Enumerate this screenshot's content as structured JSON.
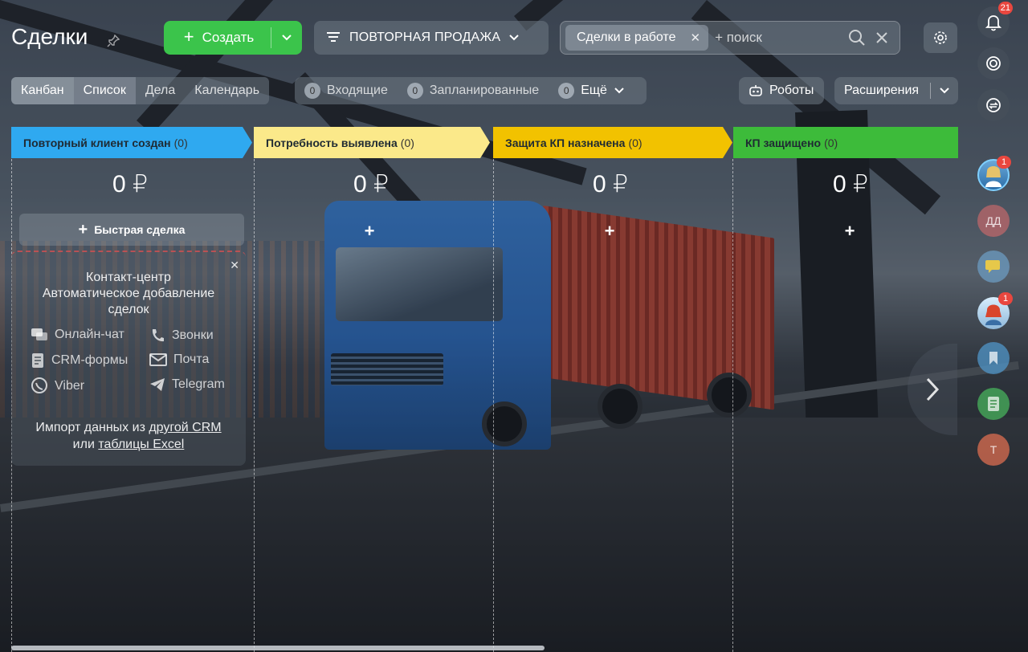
{
  "header": {
    "title": "Сделки",
    "create_label": "Создать",
    "filter_label": "ПОВТОРНАЯ ПРОДАЖА",
    "search_chip": "Сделки в работе",
    "search_placeholder": "+ поиск"
  },
  "views": [
    {
      "label": "Канбан",
      "active": true
    },
    {
      "label": "Список"
    },
    {
      "label": "Дела"
    },
    {
      "label": "Календарь"
    }
  ],
  "counters": {
    "incoming": {
      "count": "0",
      "label": "Входящие"
    },
    "planned": {
      "count": "0",
      "label": "Запланированные"
    },
    "more": {
      "count": "0",
      "label": "Ещё"
    }
  },
  "toolbar": {
    "robots_label": "Роботы",
    "extensions_label": "Расширения"
  },
  "stages": [
    {
      "name": "Повторный клиент создан",
      "count": "(0)",
      "color": "#2fa9f0",
      "sum": "0 ₽"
    },
    {
      "name": "Потребность выявлена",
      "count": "(0)",
      "color": "#fbe98a",
      "sum": "0 ₽"
    },
    {
      "name": "Защита КП назначена",
      "count": "(0)",
      "color": "#f2c200",
      "sum": "0 ₽"
    },
    {
      "name": "КП защищено",
      "count": "(0)",
      "color": "#3dbb3a",
      "sum": "0 ₽"
    }
  ],
  "quick_deal_label": "Быстрая сделка",
  "contact_center": {
    "title_line1": "Контакт-центр",
    "title_line2": "Автоматическое добавление",
    "title_line3": "сделок",
    "channels": [
      {
        "label": "Онлайн-чат",
        "icon": "chat-icon"
      },
      {
        "label": "Звонки",
        "icon": "phone-icon"
      },
      {
        "label": "CRM-формы",
        "icon": "form-icon"
      },
      {
        "label": "Почта",
        "icon": "mail-icon"
      },
      {
        "label": "Viber",
        "icon": "viber-icon"
      },
      {
        "label": "Telegram",
        "icon": "telegram-icon"
      }
    ],
    "import_text1": "Импорт данных из ",
    "import_link1": "другой CRM",
    "import_text2": "или ",
    "import_link2": "таблицы Excel"
  },
  "rail": {
    "notifications_badge": "21",
    "avatar1_badge": "1",
    "avatar_initials": "ДД",
    "avatar4_badge": "1",
    "last_initial": "Т"
  },
  "colors": {
    "create_green": "#3bc44b",
    "badge_red": "#e9473f"
  }
}
